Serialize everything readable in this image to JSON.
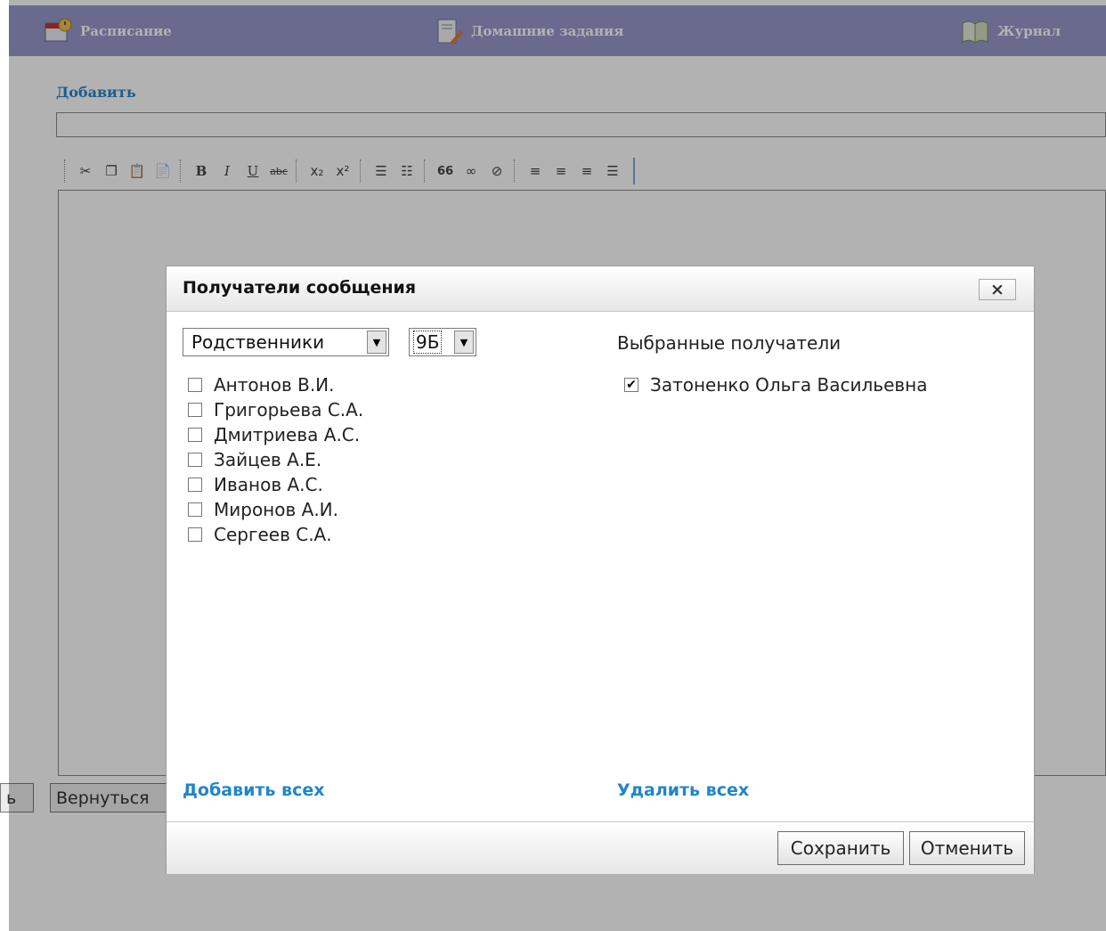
{
  "nav": {
    "items": [
      {
        "label": "Расписание",
        "icon": "calendar-icon"
      },
      {
        "label": "Домашние задания",
        "icon": "homework-icon"
      },
      {
        "label": "Журнал",
        "icon": "journal-icon"
      }
    ]
  },
  "editor": {
    "section_title": "Добавить",
    "title_value": "",
    "toolbar": [
      "cut",
      "copy",
      "paste",
      "paste-word",
      "bold",
      "italic",
      "underline",
      "strikethrough",
      "subscript",
      "superscript",
      "ordered-list",
      "unordered-list",
      "blockquote",
      "link",
      "unlink",
      "align-left",
      "align-center",
      "align-right",
      "align-justify"
    ],
    "toolbar_glyphs": {
      "bold": "B",
      "italic": "I",
      "underline": "U",
      "strikethrough": "abc",
      "subscript": "x₂",
      "superscript": "x²",
      "blockquote": "66"
    }
  },
  "background_buttons": {
    "partial_left": "ь",
    "back": "Вернуться"
  },
  "dialog": {
    "title": "Получатели сообщения",
    "close": "×",
    "role_select": "Родственники",
    "class_select": "9Б",
    "recipients": [
      {
        "name": "Антонов В.И.",
        "checked": false
      },
      {
        "name": "Григорьева С.А.",
        "checked": false
      },
      {
        "name": "Дмитриева А.С.",
        "checked": false
      },
      {
        "name": "Зайцев А.Е.",
        "checked": false
      },
      {
        "name": "Иванов А.С.",
        "checked": false
      },
      {
        "name": "Миронов А.И.",
        "checked": false
      },
      {
        "name": "Сергеев С.А.",
        "checked": false
      }
    ],
    "selected_title": "Выбранные получатели",
    "selected": [
      {
        "name": "Затоненко Ольга Васильевна",
        "checked": true
      }
    ],
    "add_all": "Добавить всех",
    "remove_all": "Удалить всех",
    "save": "Сохранить",
    "cancel": "Отменить"
  },
  "colors": {
    "nav_bg": "#9999cc",
    "link": "#1f86c8",
    "overlay": "rgba(0,0,0,0.30)"
  }
}
